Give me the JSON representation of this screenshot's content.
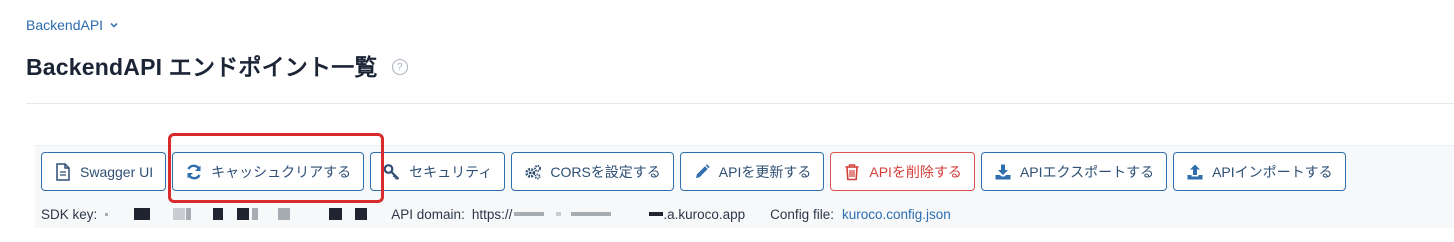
{
  "breadcrumb": {
    "label": "BackendAPI"
  },
  "page": {
    "title": "BackendAPI エンドポイント一覧",
    "help_icon": "question-circle-icon"
  },
  "toolbar": {
    "buttons": [
      {
        "label": "Swagger UI",
        "icon": "document-icon",
        "variant": "default"
      },
      {
        "label": "キャッシュクリアする",
        "icon": "refresh-icon",
        "variant": "default",
        "highlighted": true
      },
      {
        "label": "セキュリティ",
        "icon": "key-icon",
        "variant": "default"
      },
      {
        "label": "CORSを設定する",
        "icon": "gears-icon",
        "variant": "default"
      },
      {
        "label": "APIを更新する",
        "icon": "pencil-icon",
        "variant": "default"
      },
      {
        "label": "APIを削除する",
        "icon": "trash-icon",
        "variant": "danger"
      },
      {
        "label": "APIエクスポートする",
        "icon": "download-icon",
        "variant": "default"
      },
      {
        "label": "APIインポートする",
        "icon": "upload-icon",
        "variant": "default"
      }
    ]
  },
  "info": {
    "sdk_key_label": "SDK key:",
    "api_domain_label": "API domain:",
    "api_domain_prefix": "https://",
    "api_domain_suffix": ".a.kuroco.app",
    "config_file_label": "Config file:",
    "config_file_value": "kuroco.config.json"
  },
  "colors": {
    "primary": "#2f6fad",
    "danger": "#d9534f",
    "highlight": "#d92b2b",
    "link": "#2b6cb0"
  }
}
